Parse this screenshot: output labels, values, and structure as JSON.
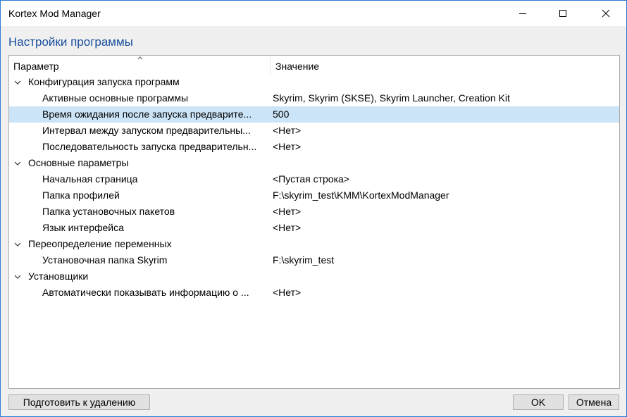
{
  "window": {
    "title": "Kortex Mod Manager"
  },
  "page": {
    "heading": "Настройки программы"
  },
  "table": {
    "columns": {
      "param": "Параметр",
      "value": "Значение"
    },
    "rows": [
      {
        "kind": "group",
        "name": "Конфигурация запуска программ",
        "value": ""
      },
      {
        "kind": "item",
        "name": "Активные основные программы",
        "value": "Skyrim, Skyrim (SKSE), Skyrim Launcher, Creation Kit"
      },
      {
        "kind": "item",
        "name": "Время ожидания после запуска предварите...",
        "value": "500",
        "selected": true
      },
      {
        "kind": "item",
        "name": "Интервал между запуском предварительны...",
        "value": "<Нет>"
      },
      {
        "kind": "item",
        "name": "Последовательность запуска предварительн...",
        "value": "<Нет>"
      },
      {
        "kind": "group",
        "name": "Основные параметры",
        "value": ""
      },
      {
        "kind": "item",
        "name": "Начальная страница",
        "value": "<Пустая строка>"
      },
      {
        "kind": "item",
        "name": "Папка профилей",
        "value": "F:\\skyrim_test\\KMM\\KortexModManager"
      },
      {
        "kind": "item",
        "name": "Папка установочных пакетов",
        "value": "<Нет>"
      },
      {
        "kind": "item",
        "name": "Язык интерфейса",
        "value": "<Нет>"
      },
      {
        "kind": "group",
        "name": "Переопределение переменных",
        "value": ""
      },
      {
        "kind": "item",
        "name": "Установочная папка Skyrim",
        "value": "F:\\skyrim_test"
      },
      {
        "kind": "group",
        "name": "Установщики",
        "value": ""
      },
      {
        "kind": "item",
        "name": "Автоматически показывать информацию о ...",
        "value": "<Нет>"
      }
    ]
  },
  "buttons": {
    "prepare": "Подготовить к удалению",
    "ok": "OK",
    "cancel": "Отмена"
  },
  "icons": {
    "minimize": "minimize-icon",
    "maximize": "maximize-icon",
    "close": "close-icon",
    "expand": "chevron-down-icon",
    "sort": "sort-ascending-icon"
  },
  "colors": {
    "heading": "#1a4e9c",
    "selection": "#cce4f7",
    "window_border": "#2b7bd1"
  }
}
